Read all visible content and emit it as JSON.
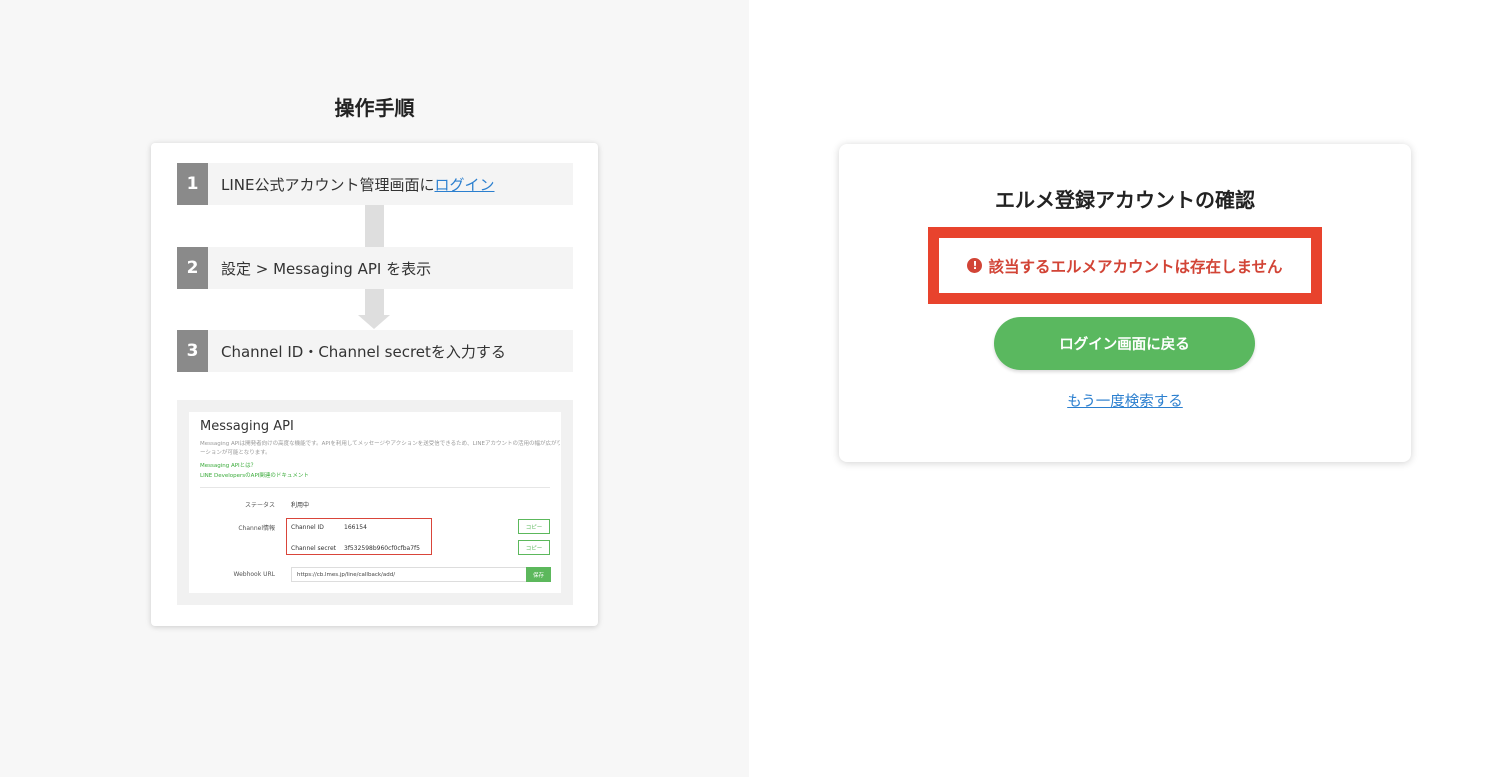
{
  "guide": {
    "title": "操作手順",
    "steps": [
      {
        "num": "1",
        "text": "LINE公式アカウント管理画面に",
        "link": "ログイン"
      },
      {
        "num": "2",
        "text": "設定 > Messaging API を表示"
      },
      {
        "num": "3",
        "text": "Channel ID・Channel secretを入力する"
      }
    ],
    "screenshot": {
      "title": "Messaging API",
      "description": "Messaging APIは開発者向けの高度な機能です。APIを利用してメッセージやアクションを送受信できるため、LINEアカウントの活用の幅が広がります。",
      "description2": "ーションが可能となります。",
      "link1": "Messaging APIとは？",
      "link2": "LINE DevelopersのAPI関連のドキュメント",
      "status_label": "ステータス",
      "status_value": "利用中",
      "channel_info_label": "Channel情報",
      "channel_id_label": "Channel ID",
      "channel_id_value": "166154",
      "channel_secret_label": "Channel secret",
      "channel_secret_value": "3f532598b960cf0cfba7f5",
      "copy_label": "コピー",
      "webhook_label": "Webhook URL",
      "webhook_value": "https://cb.lmes.jp/line/callback/add/",
      "save_label": "保存"
    }
  },
  "confirm": {
    "title": "エルメ登録アカウントの確認",
    "error_icon": "!",
    "error_message": "該当するエルメアカウントは存在しません",
    "back_button": "ログイン画面に戻る",
    "research_link": "もう一度検索する"
  },
  "colors": {
    "accent_green": "#5ab85f",
    "error_red": "#d24436",
    "highlight_red": "#e8432d",
    "link_blue": "#2b7fcf"
  }
}
